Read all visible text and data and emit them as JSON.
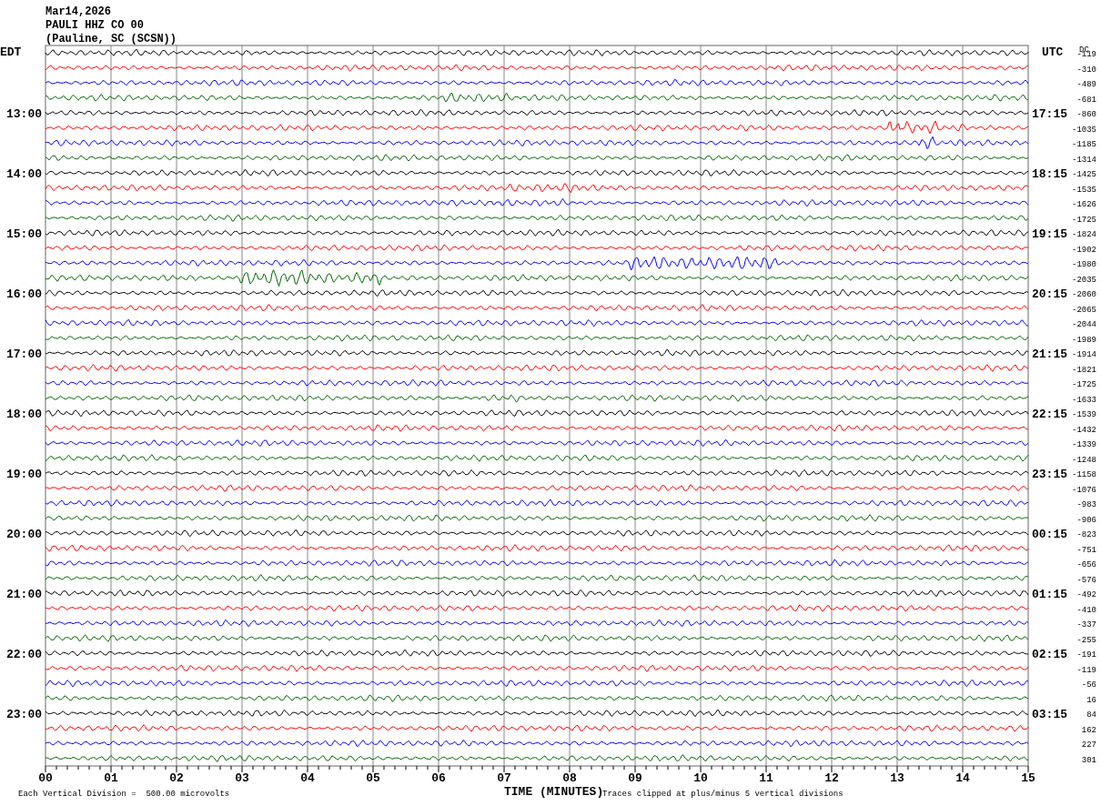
{
  "header": {
    "date": "Mar14,2026",
    "station": "PAULI HHZ CO 00",
    "location": "(Pauline, SC (SCSN))"
  },
  "left_timezone": "EDT",
  "right_timezone": "UTC",
  "dc_label": "DC",
  "rows": [
    {
      "dc": "-119",
      "color": "#000000"
    },
    {
      "dc": "-310",
      "color": "#ff0000"
    },
    {
      "dc": "-489",
      "color": "#0000ff"
    },
    {
      "dc": "-681",
      "color": "#006400"
    },
    {
      "left_time": "13:00",
      "right_time": "17:15",
      "dc": "-860",
      "color": "#000000"
    },
    {
      "dc": "-1035",
      "color": "#ff0000"
    },
    {
      "dc": "-1185",
      "color": "#0000ff"
    },
    {
      "dc": "-1314",
      "color": "#006400"
    },
    {
      "left_time": "14:00",
      "right_time": "18:15",
      "dc": "-1425",
      "color": "#000000"
    },
    {
      "dc": "-1535",
      "color": "#ff0000"
    },
    {
      "dc": "-1626",
      "color": "#0000ff"
    },
    {
      "dc": "-1725",
      "color": "#006400"
    },
    {
      "left_time": "15:00",
      "right_time": "19:15",
      "dc": "-1824",
      "color": "#000000"
    },
    {
      "dc": "-1902",
      "color": "#ff0000"
    },
    {
      "dc": "-1980",
      "color": "#0000ff"
    },
    {
      "dc": "-2035",
      "color": "#006400"
    },
    {
      "left_time": "16:00",
      "right_time": "20:15",
      "dc": "-2060",
      "color": "#000000"
    },
    {
      "dc": "-2065",
      "color": "#ff0000"
    },
    {
      "dc": "-2044",
      "color": "#0000ff"
    },
    {
      "dc": "-1989",
      "color": "#006400"
    },
    {
      "left_time": "17:00",
      "right_time": "21:15",
      "dc": "-1914",
      "color": "#000000"
    },
    {
      "dc": "-1821",
      "color": "#ff0000"
    },
    {
      "dc": "-1725",
      "color": "#0000ff"
    },
    {
      "dc": "-1633",
      "color": "#006400"
    },
    {
      "left_time": "18:00",
      "right_time": "22:15",
      "dc": "-1539",
      "color": "#000000"
    },
    {
      "dc": "-1432",
      "color": "#ff0000"
    },
    {
      "dc": "-1339",
      "color": "#0000ff"
    },
    {
      "dc": "-1248",
      "color": "#006400"
    },
    {
      "left_time": "19:00",
      "right_time": "23:15",
      "dc": "-1158",
      "color": "#000000"
    },
    {
      "dc": "-1076",
      "color": "#ff0000"
    },
    {
      "dc": "-983",
      "color": "#0000ff"
    },
    {
      "dc": "-906",
      "color": "#006400"
    },
    {
      "left_time": "20:00",
      "right_time": "00:15",
      "dc": "-823",
      "color": "#000000"
    },
    {
      "dc": "-751",
      "color": "#ff0000"
    },
    {
      "dc": "-656",
      "color": "#0000ff"
    },
    {
      "dc": "-576",
      "color": "#006400"
    },
    {
      "left_time": "21:00",
      "right_time": "01:15",
      "dc": "-492",
      "color": "#000000"
    },
    {
      "dc": "-410",
      "color": "#ff0000"
    },
    {
      "dc": "-337",
      "color": "#0000ff"
    },
    {
      "dc": "-255",
      "color": "#006400"
    },
    {
      "left_time": "22:00",
      "right_time": "02:15",
      "dc": "-191",
      "color": "#000000"
    },
    {
      "dc": "-119",
      "color": "#ff0000"
    },
    {
      "dc": "-56",
      "color": "#0000ff"
    },
    {
      "dc": "16",
      "color": "#006400"
    },
    {
      "left_time": "23:00",
      "right_time": "03:15",
      "dc": "84",
      "color": "#000000"
    },
    {
      "dc": "162",
      "color": "#ff0000"
    },
    {
      "dc": "227",
      "color": "#0000ff"
    },
    {
      "dc": "301",
      "color": "#006400"
    }
  ],
  "x_axis": {
    "ticks": [
      "00",
      "01",
      "02",
      "03",
      "04",
      "05",
      "06",
      "07",
      "08",
      "09",
      "10",
      "11",
      "12",
      "13",
      "14",
      "15"
    ],
    "title": "TIME (MINUTES)"
  },
  "footer": {
    "scale_note": "Each Vertical Division =  500.00 microvolts",
    "clip_note": "Traces clipped at plus/minus 5 vertical divisions"
  }
}
